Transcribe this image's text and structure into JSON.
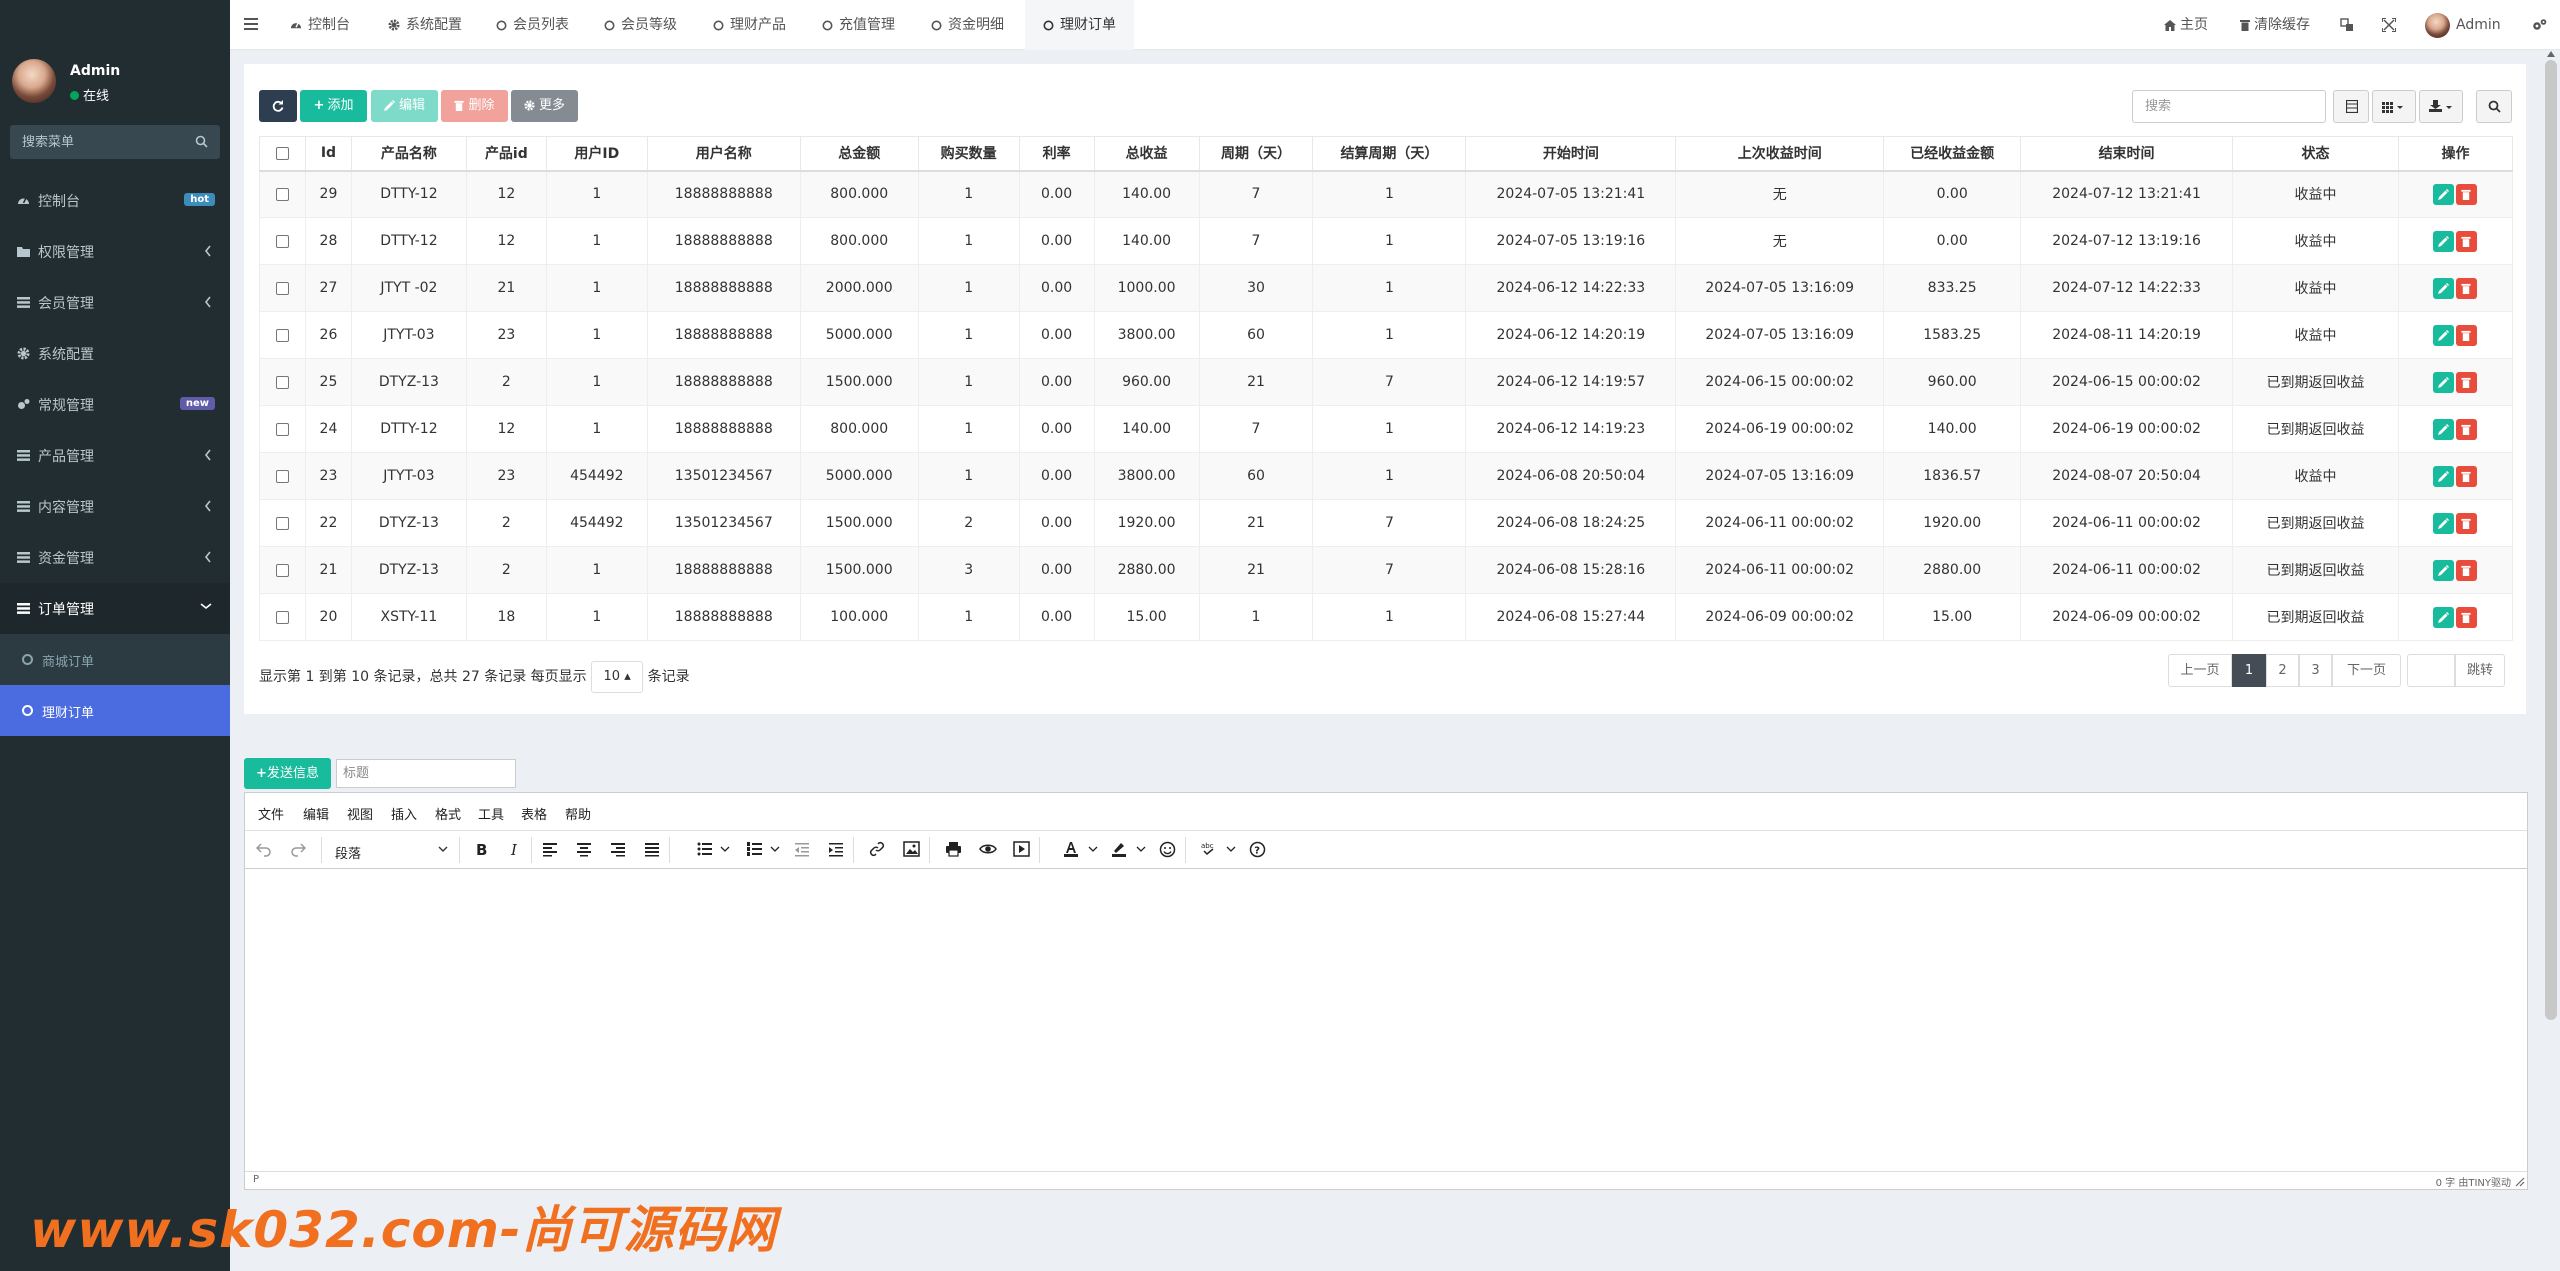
{
  "sidebar": {
    "user_name": "Admin",
    "user_status": "在线",
    "search_placeholder": "搜索菜单",
    "items": [
      {
        "label": "控制台",
        "badge": "hot",
        "badge_color": "#3c8dbc"
      },
      {
        "label": "权限管理"
      },
      {
        "label": "会员管理"
      },
      {
        "label": "系统配置"
      },
      {
        "label": "常规管理",
        "badge": "new",
        "badge_color": "#605ca8"
      },
      {
        "label": "产品管理"
      },
      {
        "label": "内容管理"
      },
      {
        "label": "资金管理"
      },
      {
        "label": "订单管理"
      }
    ],
    "sub_items": [
      {
        "label": "商城订单"
      },
      {
        "label": "理财订单"
      }
    ]
  },
  "topbar": {
    "tabs": [
      "控制台",
      "系统配置",
      "会员列表",
      "会员等级",
      "理财产品",
      "充值管理",
      "资金明细",
      "理财订单"
    ],
    "home": "主页",
    "clear_cache": "清除缓存",
    "admin": "Admin"
  },
  "toolbar": {
    "add": "添加",
    "edit": "编辑",
    "delete": "删除",
    "more": "更多",
    "search_placeholder": "搜索"
  },
  "table": {
    "columns": [
      "Id",
      "产品名称",
      "产品id",
      "用户ID",
      "用户名称",
      "总金额",
      "购买数量",
      "利率",
      "总收益",
      "周期（天）",
      "结算周期（天）",
      "开始时间",
      "上次收益时间",
      "已经收益金额",
      "结束时间",
      "状态",
      "操作"
    ],
    "rows": [
      [
        "29",
        "DTTY-12",
        "12",
        "1",
        "18888888888",
        "800.000",
        "1",
        "0.00",
        "140.00",
        "7",
        "1",
        "2024-07-05 13:21:41",
        "无",
        "0.00",
        "2024-07-12 13:21:41",
        "收益中"
      ],
      [
        "28",
        "DTTY-12",
        "12",
        "1",
        "18888888888",
        "800.000",
        "1",
        "0.00",
        "140.00",
        "7",
        "1",
        "2024-07-05 13:19:16",
        "无",
        "0.00",
        "2024-07-12 13:19:16",
        "收益中"
      ],
      [
        "27",
        "JTYT -02",
        "21",
        "1",
        "18888888888",
        "2000.000",
        "1",
        "0.00",
        "1000.00",
        "30",
        "1",
        "2024-06-12 14:22:33",
        "2024-07-05 13:16:09",
        "833.25",
        "2024-07-12 14:22:33",
        "收益中"
      ],
      [
        "26",
        "JTYT-03",
        "23",
        "1",
        "18888888888",
        "5000.000",
        "1",
        "0.00",
        "3800.00",
        "60",
        "1",
        "2024-06-12 14:20:19",
        "2024-07-05 13:16:09",
        "1583.25",
        "2024-08-11 14:20:19",
        "收益中"
      ],
      [
        "25",
        "DTYZ-13",
        "2",
        "1",
        "18888888888",
        "1500.000",
        "1",
        "0.00",
        "960.00",
        "21",
        "7",
        "2024-06-12 14:19:57",
        "2024-06-15 00:00:02",
        "960.00",
        "2024-06-15 00:00:02",
        "已到期返回收益"
      ],
      [
        "24",
        "DTTY-12",
        "12",
        "1",
        "18888888888",
        "800.000",
        "1",
        "0.00",
        "140.00",
        "7",
        "1",
        "2024-06-12 14:19:23",
        "2024-06-19 00:00:02",
        "140.00",
        "2024-06-19 00:00:02",
        "已到期返回收益"
      ],
      [
        "23",
        "JTYT-03",
        "23",
        "454492",
        "13501234567",
        "5000.000",
        "1",
        "0.00",
        "3800.00",
        "60",
        "1",
        "2024-06-08 20:50:04",
        "2024-07-05 13:16:09",
        "1836.57",
        "2024-08-07 20:50:04",
        "收益中"
      ],
      [
        "22",
        "DTYZ-13",
        "2",
        "454492",
        "13501234567",
        "1500.000",
        "2",
        "0.00",
        "1920.00",
        "21",
        "7",
        "2024-06-08 18:24:25",
        "2024-06-11 00:00:02",
        "1920.00",
        "2024-06-11 00:00:02",
        "已到期返回收益"
      ],
      [
        "21",
        "DTYZ-13",
        "2",
        "1",
        "18888888888",
        "1500.000",
        "3",
        "0.00",
        "2880.00",
        "21",
        "7",
        "2024-06-08 15:28:16",
        "2024-06-11 00:00:02",
        "2880.00",
        "2024-06-11 00:00:02",
        "已到期返回收益"
      ],
      [
        "20",
        "XSTY-11",
        "18",
        "1",
        "18888888888",
        "100.000",
        "1",
        "0.00",
        "15.00",
        "1",
        "1",
        "2024-06-08 15:27:44",
        "2024-06-09 00:00:02",
        "15.00",
        "2024-06-09 00:00:02",
        "已到期返回收益"
      ]
    ]
  },
  "pagination": {
    "info_prefix": "显示第 1 到第 10 条记录，总共 27 条记录 每页显示",
    "page_size": "10",
    "info_suffix": "条记录",
    "prev": "上一页",
    "pages": [
      "1",
      "2",
      "3"
    ],
    "next": "下一页",
    "jump": "跳转"
  },
  "editor": {
    "send_button": "发送信息",
    "title_placeholder": "标题",
    "menus": [
      "文件",
      "编辑",
      "视图",
      "插入",
      "格式",
      "工具",
      "表格",
      "帮助"
    ],
    "paragraph": "段落",
    "status_path": "P",
    "status_right": "0 字 由TINY驱动"
  },
  "watermark": "www.sk032.com-尚可源码网",
  "colors": {
    "sidebar_bg": "#222d32",
    "active_menu": "#4b6be0",
    "green": "#18bc9c",
    "danger": "#e74c3c",
    "toolbar_dark": "#2c3e50"
  }
}
